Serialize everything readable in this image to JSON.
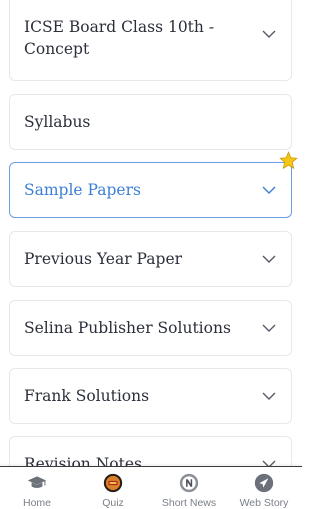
{
  "accordion": {
    "items": [
      {
        "label": "ICSE Board Class 10th - Concept",
        "active": false
      },
      {
        "label": "Syllabus",
        "active": false
      },
      {
        "label": "Sample Papers",
        "active": true
      },
      {
        "label": "Previous Year Paper",
        "active": false
      },
      {
        "label": "Selina Publisher Solutions",
        "active": false
      },
      {
        "label": "Frank Solutions",
        "active": false
      },
      {
        "label": "Revision Notes",
        "active": false
      }
    ]
  },
  "bottom_nav": {
    "items": [
      {
        "label": "Home",
        "icon": "graduation-cap-icon"
      },
      {
        "label": "Quiz",
        "icon": "quiz-icon"
      },
      {
        "label": "Short News",
        "icon": "news-icon"
      },
      {
        "label": "Web Story",
        "icon": "web-story-icon"
      }
    ]
  },
  "colors": {
    "accent": "#3b7fd6",
    "text": "#2b2f3a",
    "border": "#e6e8ec",
    "nav_text": "#7a7f88",
    "star": "#f5c518"
  }
}
